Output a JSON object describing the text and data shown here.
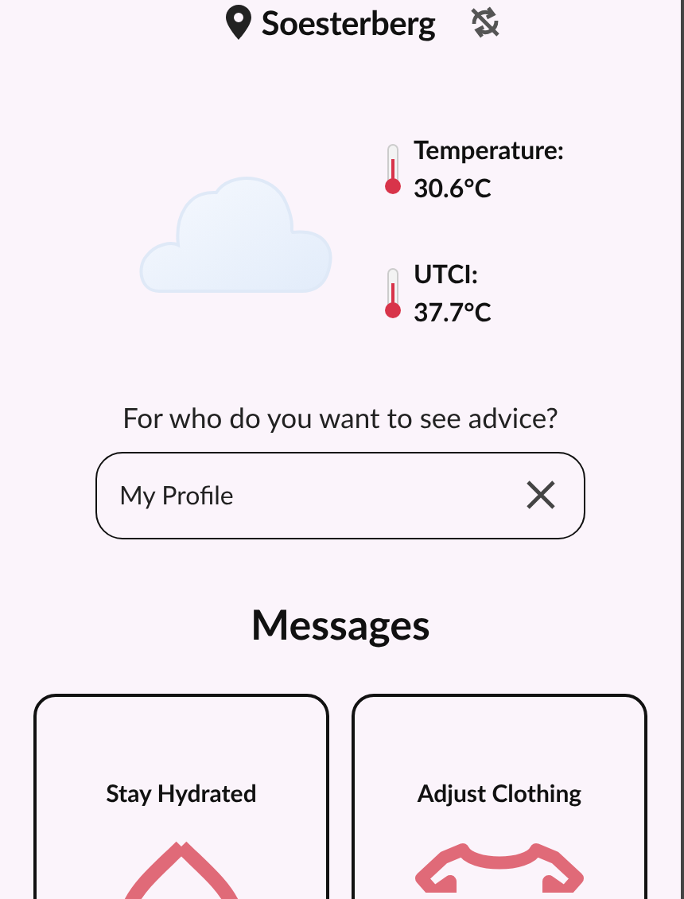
{
  "header": {
    "location": "Soesterberg",
    "sync_disabled": true
  },
  "weather": {
    "readings": [
      {
        "label": "Temperature:",
        "value": "30.6°C"
      },
      {
        "label": "UTCI:",
        "value": "37.7°C"
      }
    ]
  },
  "advice": {
    "question": "For who do you want to see advice?",
    "value": "My Profile"
  },
  "messages": {
    "title": "Messages",
    "cards": [
      {
        "title": "Stay Hydrated",
        "kind": "drop"
      },
      {
        "title": "Adjust Clothing",
        "kind": "shirt"
      }
    ]
  }
}
